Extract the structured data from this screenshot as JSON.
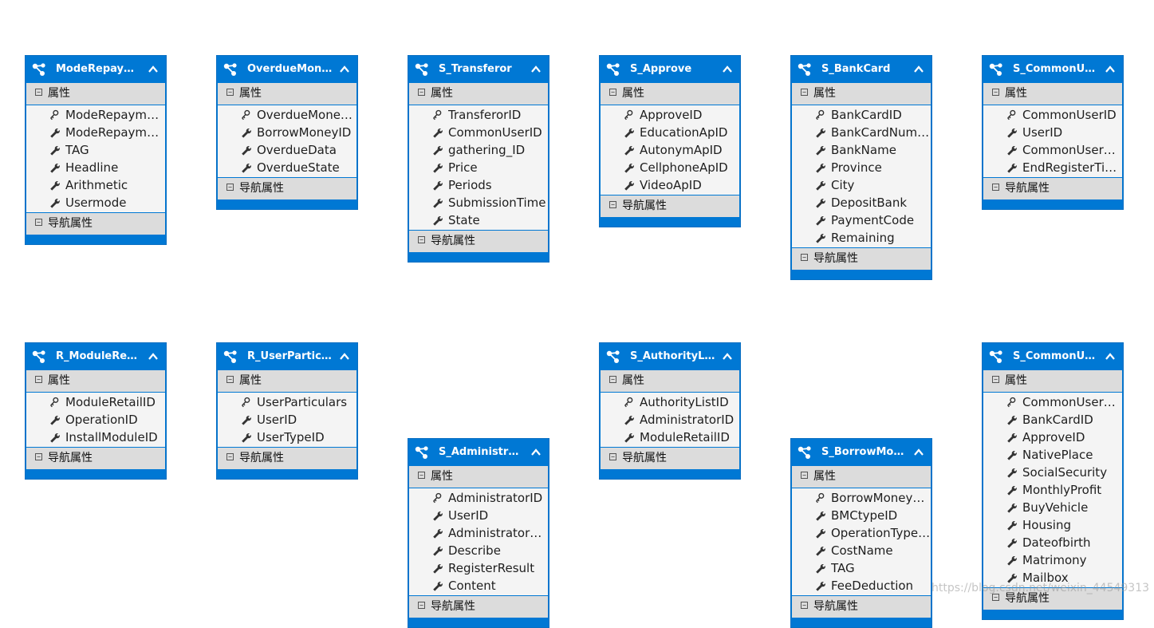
{
  "section_labels": {
    "properties": "属性",
    "navigation": "导航属性"
  },
  "entities": [
    {
      "title": "ModeRepay…",
      "properties": [
        {
          "name": "ModeRepayme…",
          "key": true
        },
        {
          "name": "ModeRepayme…",
          "key": false
        },
        {
          "name": "TAG",
          "key": false
        },
        {
          "name": "Headline",
          "key": false
        },
        {
          "name": "Arithmetic",
          "key": false
        },
        {
          "name": "Usermode",
          "key": false
        }
      ]
    },
    {
      "title": "OverdueMon…",
      "properties": [
        {
          "name": "OverdueMone…",
          "key": true
        },
        {
          "name": "BorrowMoneyID",
          "key": false
        },
        {
          "name": "OverdueData",
          "key": false
        },
        {
          "name": "OverdueState",
          "key": false
        }
      ]
    },
    {
      "title": "S_Transferor",
      "properties": [
        {
          "name": "TransferorID",
          "key": true
        },
        {
          "name": "CommonUserID",
          "key": false
        },
        {
          "name": "gathering_ID",
          "key": false
        },
        {
          "name": "Price",
          "key": false
        },
        {
          "name": "Periods",
          "key": false
        },
        {
          "name": "SubmissionTime",
          "key": false
        },
        {
          "name": "State",
          "key": false
        }
      ]
    },
    {
      "title": "S_Approve",
      "properties": [
        {
          "name": "ApproveID",
          "key": true
        },
        {
          "name": "EducationApID",
          "key": false
        },
        {
          "name": "AutonymApID",
          "key": false
        },
        {
          "name": "CellphoneApID",
          "key": false
        },
        {
          "name": "VideoApID",
          "key": false
        }
      ]
    },
    {
      "title": "S_BankCard",
      "properties": [
        {
          "name": "BankCardID",
          "key": true
        },
        {
          "name": "BankCardNum…",
          "key": false
        },
        {
          "name": "BankName",
          "key": false
        },
        {
          "name": "Province",
          "key": false
        },
        {
          "name": "City",
          "key": false
        },
        {
          "name": "DepositBank",
          "key": false
        },
        {
          "name": "PaymentCode",
          "key": false
        },
        {
          "name": "Remaining",
          "key": false
        }
      ]
    },
    {
      "title": "S_CommonU…",
      "properties": [
        {
          "name": "CommonUserID",
          "key": true
        },
        {
          "name": "UserID",
          "key": false
        },
        {
          "name": "CommonUser…",
          "key": false
        },
        {
          "name": "EndRegisterTime",
          "key": false
        }
      ]
    },
    {
      "title": "R_ModuleRet…",
      "properties": [
        {
          "name": "ModuleRetailID",
          "key": true
        },
        {
          "name": "OperationID",
          "key": false
        },
        {
          "name": "InstallModuleID",
          "key": false
        }
      ]
    },
    {
      "title": "R_UserPartic…",
      "properties": [
        {
          "name": "UserParticulars",
          "key": true
        },
        {
          "name": "UserID",
          "key": false
        },
        {
          "name": "UserTypeID",
          "key": false
        }
      ]
    },
    {
      "title": "S_Administra…",
      "properties": [
        {
          "name": "AdministratorID",
          "key": true
        },
        {
          "name": "UserID",
          "key": false
        },
        {
          "name": "AdministratorA…",
          "key": false
        },
        {
          "name": "Describe",
          "key": false
        },
        {
          "name": "RegisterResult",
          "key": false
        },
        {
          "name": "Content",
          "key": false
        }
      ]
    },
    {
      "title": "S_AuthorityList",
      "properties": [
        {
          "name": "AuthorityListID",
          "key": true
        },
        {
          "name": "AdministratorID",
          "key": false
        },
        {
          "name": "ModuleRetailID",
          "key": false
        }
      ]
    },
    {
      "title": "S_BorrowMo…",
      "properties": [
        {
          "name": "BorrowMoney…",
          "key": true
        },
        {
          "name": "BMCtypeID",
          "key": false
        },
        {
          "name": "OperationType…",
          "key": false
        },
        {
          "name": "CostName",
          "key": false
        },
        {
          "name": "TAG",
          "key": false
        },
        {
          "name": "FeeDeduction",
          "key": false
        }
      ]
    },
    {
      "title": "S_CommonU…",
      "properties": [
        {
          "name": "CommonUser…",
          "key": true
        },
        {
          "name": "BankCardID",
          "key": false
        },
        {
          "name": "ApproveID",
          "key": false
        },
        {
          "name": "NativePlace",
          "key": false
        },
        {
          "name": "SocialSecurity",
          "key": false
        },
        {
          "name": "MonthlyProfit",
          "key": false
        },
        {
          "name": "BuyVehicle",
          "key": false
        },
        {
          "name": "Housing",
          "key": false
        },
        {
          "name": "Dateofbirth",
          "key": false
        },
        {
          "name": "Matrimony",
          "key": false
        },
        {
          "name": "Mailbox",
          "key": false
        }
      ]
    }
  ],
  "watermark": "https://blog.csdn.net/weixin_44549313"
}
